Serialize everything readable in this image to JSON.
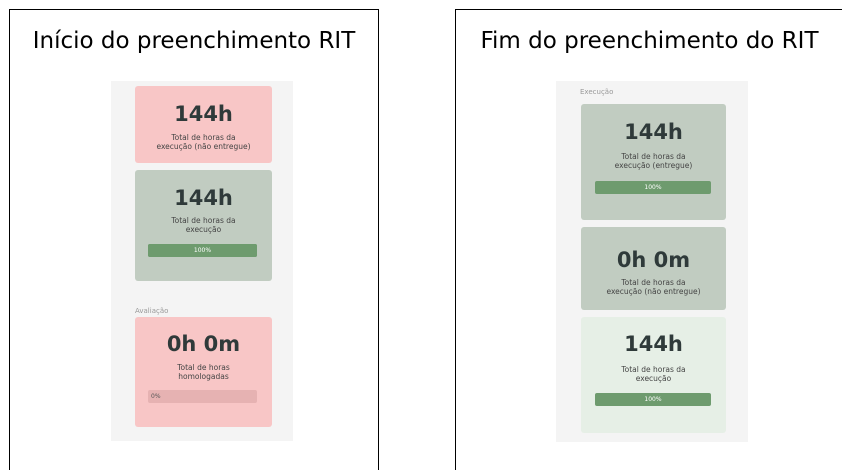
{
  "left": {
    "title": "Início do preenchimento RIT",
    "cards": [
      {
        "value": "144h",
        "desc1": "Total de horas da",
        "desc2": "execução (não entregue)"
      },
      {
        "value": "144h",
        "desc1": "Total de horas da",
        "desc2": "execução",
        "progress_label": "100%",
        "progress": 1.0
      },
      {
        "value": "0h 0m",
        "desc1": "Total de horas",
        "desc2": "homologadas",
        "progress_label": "0%",
        "progress": 0.0
      }
    ],
    "section_label": "Avaliação"
  },
  "right": {
    "title": "Fim do preenchimento do RIT",
    "section_label": "Execução",
    "cards": [
      {
        "value": "144h",
        "desc1": "Total de horas da",
        "desc2": "execução (entregue)",
        "progress_label": "100%",
        "progress": 1.0
      },
      {
        "value": "0h 0m",
        "desc1": "Total de horas da",
        "desc2": "execução (não entregue)"
      },
      {
        "value": "144h",
        "desc1": "Total de horas da",
        "desc2": "execução",
        "progress_label": "100%",
        "progress": 1.0
      }
    ]
  },
  "colors": {
    "card_red": "#f8c6c6",
    "card_green": "#c1ccc1",
    "card_light": "#e6efe6",
    "progress_fill": "#6e9b6e",
    "screen_bg": "#f4f4f4"
  }
}
